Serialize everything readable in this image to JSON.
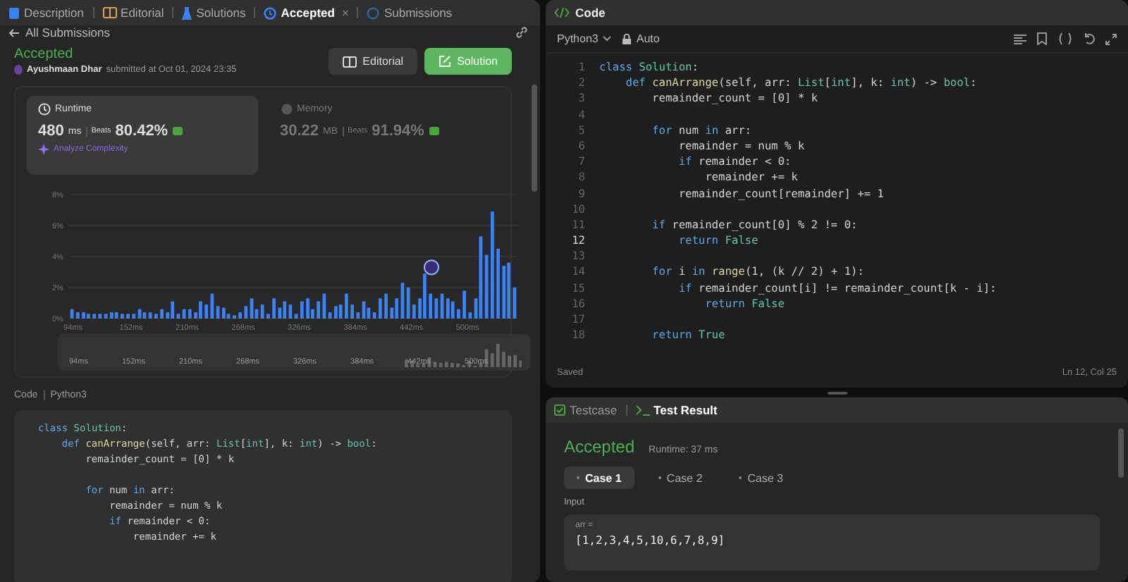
{
  "left_tabs": [
    {
      "label": "Description",
      "selected": false
    },
    {
      "label": "Editorial",
      "selected": false
    },
    {
      "label": "Solutions",
      "selected": false
    },
    {
      "label": "Accepted",
      "selected": true,
      "close": "×"
    },
    {
      "label": "Submissions",
      "selected": false
    }
  ],
  "back_link": "All Submissions",
  "submission": {
    "status": "Accepted",
    "author": "Ayushmaan Dhar",
    "submitted": "submitted at Oct 01, 2024 23:35",
    "buttons": [
      {
        "label": "Editorial",
        "kind": "secondary"
      },
      {
        "label": "Solution",
        "kind": "primary"
      }
    ]
  },
  "metrics": [
    {
      "title": "Runtime",
      "value": "480",
      "unit": "ms",
      "beats_label": "Beats",
      "beats": "80.42%",
      "selected": true,
      "link": "Analyze Complexity"
    },
    {
      "title": "Memory",
      "value": "30.22",
      "unit": "MB",
      "beats_label": "Beats",
      "beats": "91.94%",
      "selected": false
    }
  ],
  "chart_data": {
    "type": "bar",
    "grid": true,
    "xlim": [
      91,
      555
    ],
    "ylim": [
      0,
      8
    ],
    "yticks": [
      {
        "value": 0,
        "label": "0%"
      },
      {
        "value": 2,
        "label": "2%"
      },
      {
        "value": 4,
        "label": "4%"
      },
      {
        "value": 6,
        "label": "6%"
      },
      {
        "value": 8,
        "label": "8%"
      }
    ],
    "xticks": [
      {
        "value": 94,
        "label": "94ms"
      },
      {
        "value": 152,
        "label": "152ms"
      },
      {
        "value": 210,
        "label": "210ms"
      },
      {
        "value": 268,
        "label": "268ms"
      },
      {
        "value": 326,
        "label": "326ms"
      },
      {
        "value": 384,
        "label": "384ms"
      },
      {
        "value": 442,
        "label": "442ms"
      },
      {
        "value": 500,
        "label": "500ms"
      }
    ],
    "x": [
      94,
      100,
      106,
      111,
      117,
      123,
      129,
      135,
      140,
      146,
      152,
      158,
      164,
      169,
      175,
      181,
      187,
      193,
      198,
      204,
      210,
      216,
      222,
      227,
      233,
      239,
      245,
      251,
      256,
      262,
      268,
      274,
      280,
      285,
      291,
      297,
      303,
      309,
      314,
      320,
      326,
      332,
      338,
      343,
      349,
      355,
      361,
      367,
      372,
      378,
      384,
      390,
      396,
      401,
      407,
      413,
      419,
      425,
      430,
      436,
      442,
      448,
      454,
      459,
      465,
      471,
      477,
      483,
      488,
      494,
      500,
      506,
      512,
      517,
      523,
      529,
      535,
      541,
      546,
      552
    ],
    "series": [
      {
        "color": "#3b82f6",
        "values": [
          0.6,
          0.4,
          0.4,
          0.3,
          0.3,
          0.3,
          0.3,
          0.4,
          0.4,
          0.3,
          0.3,
          0.3,
          0.6,
          0.4,
          0.4,
          0.3,
          0.6,
          0.4,
          1.1,
          0.3,
          0.6,
          0.6,
          0.4,
          1.1,
          0.9,
          1.6,
          0.8,
          0.7,
          0.3,
          0.2,
          0.4,
          0.8,
          1.3,
          0.6,
          0.9,
          0.3,
          1.3,
          0.7,
          1.1,
          0.9,
          0.3,
          1.1,
          1.3,
          0.6,
          1.1,
          1.6,
          0.4,
          0.8,
          0.9,
          1.6,
          0.9,
          0.4,
          1.1,
          0.7,
          0.4,
          1.3,
          1.6,
          0.7,
          1.3,
          2.3,
          2.0,
          0.9,
          1.3,
          2.9,
          1.6,
          1.3,
          1.6,
          1.3,
          1.1,
          0.6,
          1.8,
          0.4,
          1.3,
          5.3,
          4.1,
          6.9,
          4.5,
          3.4,
          3.6,
          2.0
        ]
      }
    ]
  },
  "range_labels": [
    "94ms",
    "152ms",
    "210ms",
    "268ms",
    "326ms",
    "384ms",
    "442ms",
    "500ms"
  ],
  "submission_code": {
    "label": "Code",
    "language": "Python3",
    "lines": [
      {
        "kind": "code",
        "tokens": [
          {
            "text": "class ",
            "kind": "keyword"
          },
          {
            "text": "Solution",
            "kind": "type"
          },
          {
            "text": ":",
            "kind": "plain"
          }
        ]
      },
      {
        "kind": "code",
        "tokens": [
          {
            "text": "    def ",
            "kind": "keyword"
          },
          {
            "text": "canArrange",
            "kind": "function"
          },
          {
            "text": "(self, arr: ",
            "kind": "plain"
          },
          {
            "text": "List",
            "kind": "type"
          },
          {
            "text": "[",
            "kind": "plain"
          },
          {
            "text": "int",
            "kind": "type"
          },
          {
            "text": "], k: ",
            "kind": "plain"
          },
          {
            "text": "int",
            "kind": "type"
          },
          {
            "text": ") -> ",
            "kind": "plain"
          },
          {
            "text": "bool",
            "kind": "type"
          },
          {
            "text": ":",
            "kind": "plain"
          }
        ]
      },
      {
        "kind": "code",
        "tokens": [
          {
            "text": "        remainder_count = [0] * k",
            "kind": "plain"
          }
        ]
      },
      {
        "kind": "blank"
      },
      {
        "kind": "code",
        "tokens": [
          {
            "text": "        for",
            "kind": "keyword"
          },
          {
            "text": " num ",
            "kind": "plain"
          },
          {
            "text": "in",
            "kind": "keyword"
          },
          {
            "text": " arr:",
            "kind": "plain"
          }
        ]
      },
      {
        "kind": "code",
        "tokens": [
          {
            "text": "            remainder = num % k",
            "kind": "plain"
          }
        ]
      },
      {
        "kind": "code",
        "tokens": [
          {
            "text": "            if",
            "kind": "keyword"
          },
          {
            "text": " remainder < 0:",
            "kind": "plain"
          }
        ]
      },
      {
        "kind": "code",
        "tokens": [
          {
            "text": "                remainder += k",
            "kind": "plain"
          }
        ]
      }
    ]
  },
  "editor": {
    "title": "Code",
    "language": "Python3",
    "mode": "Auto",
    "status": "Saved",
    "cursor": "Ln 12, Col 25",
    "lines": [
      {
        "n": "1",
        "current": false,
        "tokens": [
          {
            "text": "class ",
            "kind": "keyword"
          },
          {
            "text": "Solution",
            "kind": "type"
          },
          {
            "text": ":",
            "kind": "plain"
          }
        ]
      },
      {
        "n": "2",
        "current": false,
        "tokens": [
          {
            "text": "    def ",
            "kind": "keyword"
          },
          {
            "text": "canArrange",
            "kind": "function"
          },
          {
            "text": "(self, arr: ",
            "kind": "plain"
          },
          {
            "text": "List",
            "kind": "type"
          },
          {
            "text": "[",
            "kind": "plain"
          },
          {
            "text": "int",
            "kind": "type"
          },
          {
            "text": "], k: ",
            "kind": "plain"
          },
          {
            "text": "int",
            "kind": "type"
          },
          {
            "text": ") -> ",
            "kind": "plain"
          },
          {
            "text": "bool",
            "kind": "type"
          },
          {
            "text": ":",
            "kind": "plain"
          }
        ]
      },
      {
        "n": "3",
        "current": false,
        "tokens": [
          {
            "text": "        remainder_count = [0] * k",
            "kind": "plain"
          }
        ]
      },
      {
        "n": "4",
        "current": false
      },
      {
        "n": "5",
        "current": false,
        "tokens": [
          {
            "text": "        for",
            "kind": "keyword"
          },
          {
            "text": " num ",
            "kind": "plain"
          },
          {
            "text": "in",
            "kind": "keyword"
          },
          {
            "text": " arr:",
            "kind": "plain"
          }
        ]
      },
      {
        "n": "6",
        "current": false,
        "tokens": [
          {
            "text": "            remainder = num % k",
            "kind": "plain"
          }
        ]
      },
      {
        "n": "7",
        "current": false,
        "tokens": [
          {
            "text": "            if",
            "kind": "keyword"
          },
          {
            "text": " remainder < 0:",
            "kind": "plain"
          }
        ]
      },
      {
        "n": "8",
        "current": false,
        "tokens": [
          {
            "text": "                remainder += k",
            "kind": "plain"
          }
        ]
      },
      {
        "n": "9",
        "current": false,
        "tokens": [
          {
            "text": "            remainder_count[remainder] += 1",
            "kind": "plain"
          }
        ]
      },
      {
        "n": "10",
        "current": false
      },
      {
        "n": "11",
        "current": false,
        "tokens": [
          {
            "text": "        if",
            "kind": "keyword"
          },
          {
            "text": " remainder_count[0] % 2 != 0:",
            "kind": "plain"
          }
        ]
      },
      {
        "n": "12",
        "current": true,
        "tokens": [
          {
            "text": "            return ",
            "kind": "keyword"
          },
          {
            "text": "False",
            "kind": "type"
          }
        ]
      },
      {
        "n": "13",
        "current": false
      },
      {
        "n": "14",
        "current": false,
        "tokens": [
          {
            "text": "        for",
            "kind": "keyword"
          },
          {
            "text": " i ",
            "kind": "plain"
          },
          {
            "text": "in ",
            "kind": "keyword"
          },
          {
            "text": "range",
            "kind": "function"
          },
          {
            "text": "(1, (k // 2) + 1):",
            "kind": "plain"
          }
        ]
      },
      {
        "n": "15",
        "current": false,
        "tokens": [
          {
            "text": "            if",
            "kind": "keyword"
          },
          {
            "text": " remainder_count[i] != remainder_count[k - i]:",
            "kind": "plain"
          }
        ]
      },
      {
        "n": "16",
        "current": false,
        "tokens": [
          {
            "text": "                return ",
            "kind": "keyword"
          },
          {
            "text": "False",
            "kind": "type"
          }
        ]
      },
      {
        "n": "17",
        "current": false
      },
      {
        "n": "18",
        "current": false,
        "tokens": [
          {
            "text": "        return ",
            "kind": "keyword"
          },
          {
            "text": "True",
            "kind": "type"
          }
        ]
      }
    ]
  },
  "result_tabs": [
    {
      "label": "Testcase",
      "selected": false
    },
    {
      "label": "Test Result",
      "selected": true
    }
  ],
  "result": {
    "status": "Accepted",
    "runtime": "Runtime: 37 ms",
    "cases": [
      {
        "label": "Case 1",
        "selected": true
      },
      {
        "label": "Case 2",
        "selected": false
      },
      {
        "label": "Case 3",
        "selected": false
      }
    ],
    "input_label": "Input",
    "param": "arr =",
    "value": "[1,2,3,4,5,10,6,7,8,9]"
  }
}
